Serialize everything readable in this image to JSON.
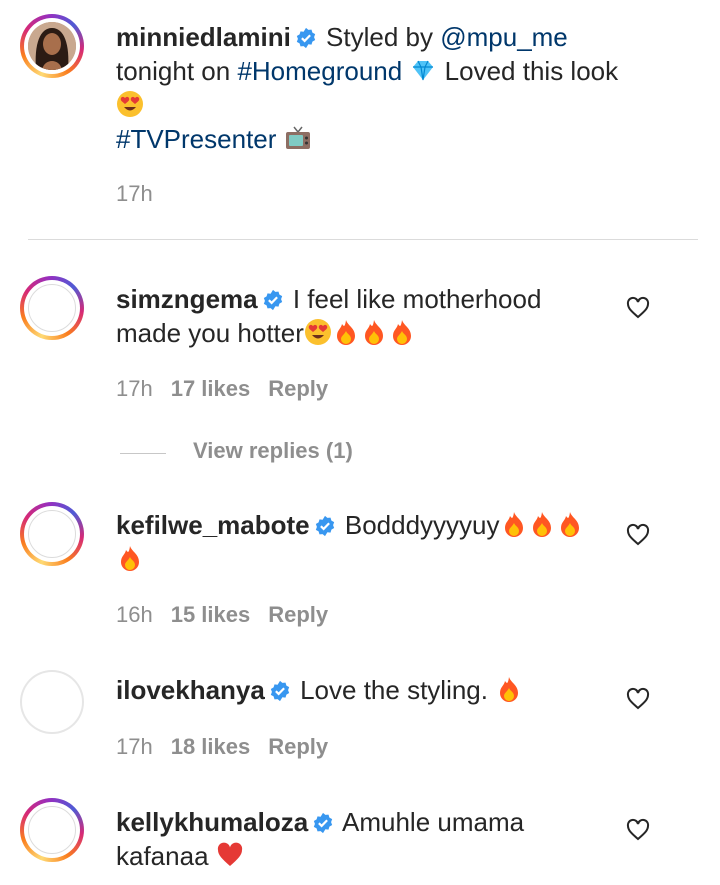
{
  "caption": {
    "username": "minniedlamini",
    "text_1": "Styled by ",
    "mention": "@mpu_me",
    "text_2": "tonight on ",
    "hashtag_1": "#Homeground",
    "text_3": " Loved this look",
    "hashtag_2": "#TVPresenter",
    "time": "17h"
  },
  "comments": [
    {
      "username": "simzngema",
      "text_1": "I feel like motherhood",
      "text_2": "made you hotter",
      "time": "17h",
      "likes": "17 likes",
      "reply": "Reply"
    },
    {
      "username": "kefilwe_mabote",
      "text_1": "Bodddyyyyuy",
      "time": "16h",
      "likes": "15 likes",
      "reply": "Reply"
    },
    {
      "username": "ilovekhanya",
      "text_1": "Love the styling. ",
      "time": "17h",
      "likes": "18 likes",
      "reply": "Reply"
    },
    {
      "username": "kellykhumaloza",
      "text_1": "Amuhle umama",
      "text_2": "kafanaa"
    }
  ],
  "view_replies": "View replies (1)",
  "colors": {
    "link": "#00376b",
    "meta": "#8e8e8e",
    "verified": "#3897f0",
    "divider": "#dbdbdb"
  }
}
